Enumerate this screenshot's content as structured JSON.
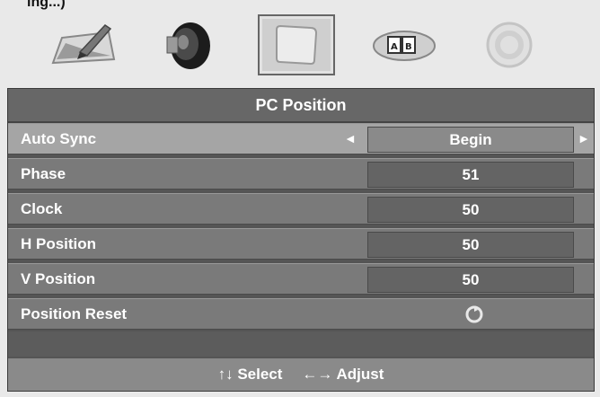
{
  "top_fragment": "ing...)",
  "icons": [
    {
      "name": "picture-icon"
    },
    {
      "name": "sound-icon"
    },
    {
      "name": "pc-position-icon",
      "selected": true
    },
    {
      "name": "setup-icon"
    },
    {
      "name": "option-icon"
    }
  ],
  "menu": {
    "title": "PC Position",
    "rows": [
      {
        "label": "Auto Sync",
        "value": "Begin",
        "left_arrow": "◄",
        "right_arrow": "►"
      },
      {
        "label": "Phase",
        "value": "51"
      },
      {
        "label": "Clock",
        "value": "50"
      },
      {
        "label": "H Position",
        "value": "50"
      },
      {
        "label": "V Position",
        "value": "50"
      },
      {
        "label": "Position Reset"
      }
    ]
  },
  "footer": {
    "select_arrows": "↑↓",
    "select_label": "Select",
    "adjust_arrows": "←→",
    "adjust_label": "Adjust"
  }
}
